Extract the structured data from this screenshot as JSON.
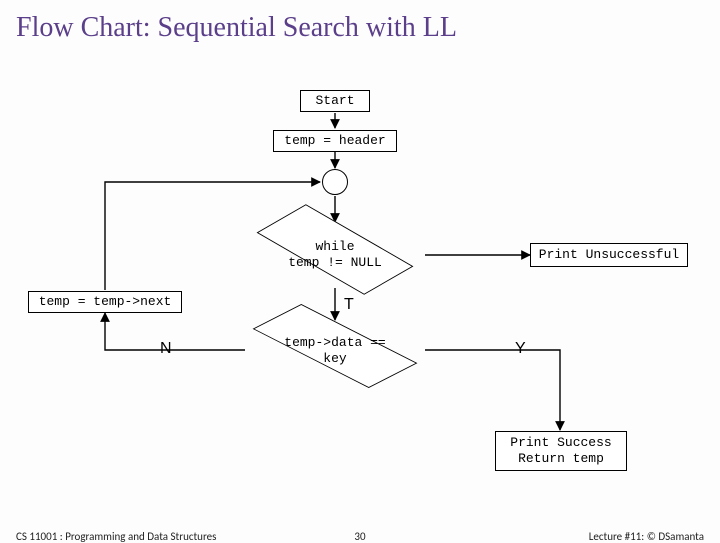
{
  "title": "Flow Chart: Sequential Search with LL",
  "nodes": {
    "start": "Start",
    "init": "temp = header",
    "while_l1": "while",
    "while_l2": "temp != NULL",
    "fail": "Print Unsuccessful",
    "next": "temp = temp->next",
    "cmp_l1": "temp->data ==",
    "cmp_l2": "key",
    "succ_l1": "Print Success",
    "succ_l2": "Return temp"
  },
  "edge_labels": {
    "T": "T",
    "N": "N",
    "Y": "Y"
  },
  "footer": {
    "left": "CS 11001 : Programming and Data Structures",
    "mid": "30",
    "right": "Lecture #11: © DSamanta"
  },
  "chart_data": {
    "type": "flowchart",
    "title": "Sequential Search with Linked List",
    "nodes": [
      {
        "id": "start",
        "kind": "terminator",
        "label": "Start"
      },
      {
        "id": "init",
        "kind": "process",
        "label": "temp = header"
      },
      {
        "id": "join",
        "kind": "connector",
        "label": ""
      },
      {
        "id": "loop",
        "kind": "decision",
        "label": "while temp != NULL"
      },
      {
        "id": "fail",
        "kind": "process",
        "label": "Print Unsuccessful"
      },
      {
        "id": "cmp",
        "kind": "decision",
        "label": "temp->data == key"
      },
      {
        "id": "next",
        "kind": "process",
        "label": "temp = temp->next"
      },
      {
        "id": "succ",
        "kind": "process",
        "label": "Print Success; Return temp"
      }
    ],
    "edges": [
      {
        "from": "start",
        "to": "init"
      },
      {
        "from": "init",
        "to": "join"
      },
      {
        "from": "join",
        "to": "loop"
      },
      {
        "from": "loop",
        "to": "fail",
        "label": "false"
      },
      {
        "from": "loop",
        "to": "cmp",
        "label": "T"
      },
      {
        "from": "cmp",
        "to": "succ",
        "label": "Y"
      },
      {
        "from": "cmp",
        "to": "next",
        "label": "N"
      },
      {
        "from": "next",
        "to": "join"
      }
    ]
  }
}
